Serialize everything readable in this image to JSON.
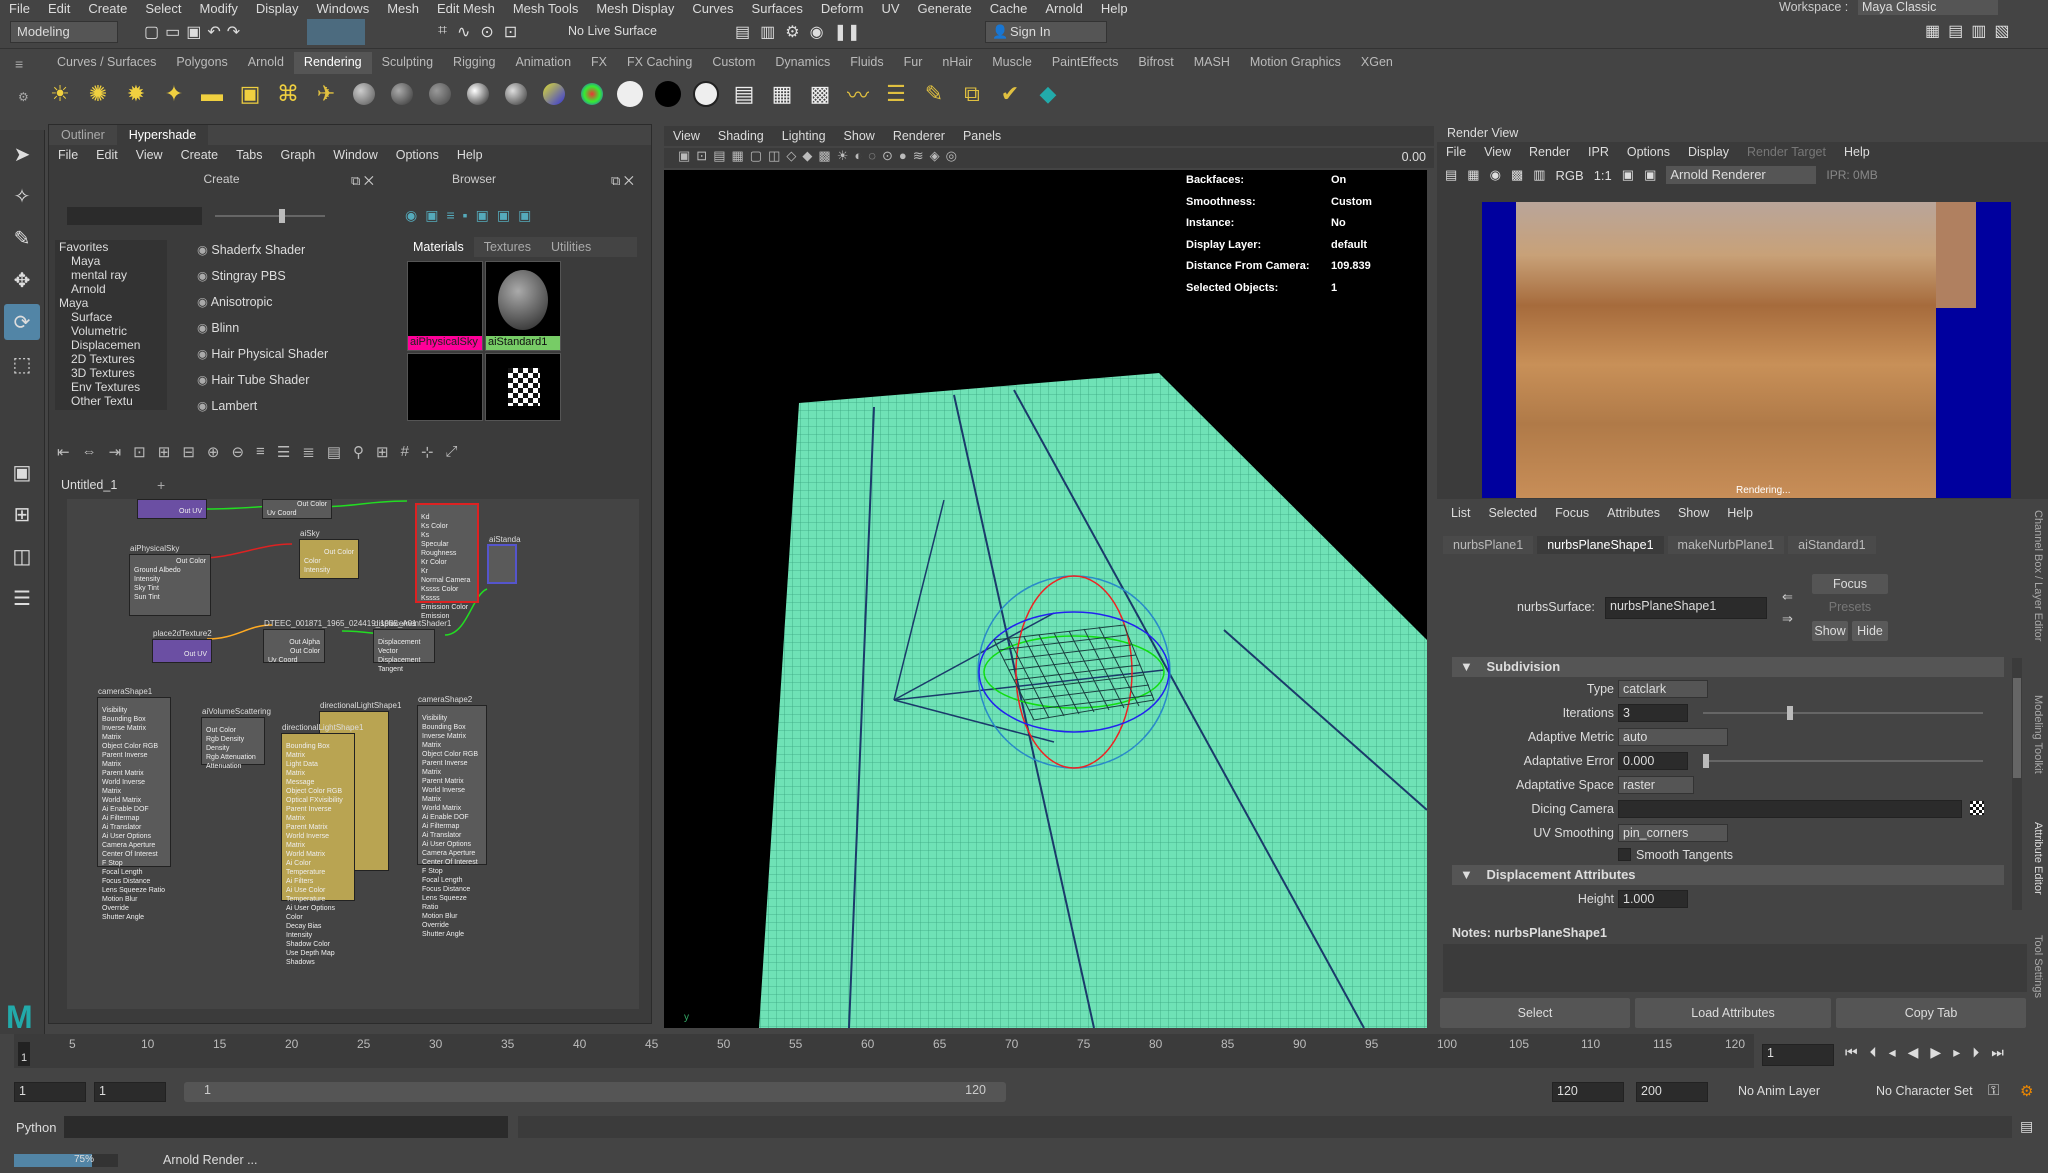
{
  "menubar": {
    "items": [
      "File",
      "Edit",
      "Create",
      "Select",
      "Modify",
      "Display",
      "Windows",
      "Mesh",
      "Edit Mesh",
      "Mesh Tools",
      "Mesh Display",
      "Curves",
      "Surfaces",
      "Deform",
      "UV",
      "Generate",
      "Cache",
      "Arnold",
      "Help"
    ],
    "workspace_label": "Workspace :",
    "workspace_value": "Maya Classic"
  },
  "statusline": {
    "mode": "Modeling",
    "live_surface": "No Live Surface",
    "sign_in": "Sign In"
  },
  "shelf": {
    "tabs": [
      "Curves / Surfaces",
      "Polygons",
      "Arnold",
      "Rendering",
      "Sculpting",
      "Rigging",
      "Animation",
      "FX",
      "FX Caching",
      "Custom",
      "Dynamics",
      "Fluids",
      "Fur",
      "nHair",
      "Muscle",
      "PaintEffects",
      "Bifrost",
      "MASH",
      "Motion Graphics",
      "XGen"
    ],
    "active_tab": "Rendering"
  },
  "hypershade": {
    "tabs": [
      "Outliner",
      "Hypershade"
    ],
    "menu": [
      "File",
      "Edit",
      "View",
      "Create",
      "Tabs",
      "Graph",
      "Window",
      "Options",
      "Help"
    ],
    "create_title": "Create",
    "browser_title": "Browser",
    "tree": [
      "Favorites",
      "Maya",
      "mental ray",
      "Arnold",
      "Maya",
      "Surface",
      "Volumetric",
      "Displacemen",
      "2D Textures",
      "3D Textures",
      "Env Textures",
      "Other Textu"
    ],
    "shader_list": [
      "Shaderfx Shader",
      "Stingray PBS",
      "Anisotropic",
      "Blinn",
      "Hair Physical Shader",
      "Hair Tube Shader",
      "Lambert"
    ],
    "browser_tabs": [
      "Materials",
      "Textures",
      "Utilities"
    ],
    "swatches": [
      "aiPhysicalSky",
      "aiStandard1"
    ],
    "graph_tab": "Untitled_1",
    "nodes": {
      "aiPhysicalSky": "aiPhysicalSky",
      "aiSky": "aiSky",
      "place2dTexture2": "place2dTexture2",
      "texture": "DTEEC_001871_1965_024419_1965_A01",
      "displacement": "displacementShader1",
      "aiStandard": "aiStanda",
      "cameraShape1": "cameraShape1",
      "aiVolumeScattering": "aiVolumeScattering",
      "dirLight1": "directionalLightShape1",
      "dirLight2": "directionalLightShape1",
      "cameraShape2": "cameraShape2"
    },
    "port_lines": {
      "sky": [
        "Out Color",
        "Ground Albedo",
        "Intensity",
        "Sky Tint",
        "Sun Tint"
      ],
      "aisky": [
        "Color",
        "Intensity",
        "Out Color"
      ],
      "place2d": [
        "Out UV"
      ],
      "tex": [
        "Out Alpha",
        "Out Color",
        "Uv Coord"
      ],
      "disp": [
        "Displacement",
        "Vector Displacement",
        "Tangent"
      ],
      "std": [
        "Kd",
        "Ks Color",
        "Ks",
        "Specular Roughness",
        "Kr Color",
        "Kr",
        "Normal Camera",
        "Kssss Color",
        "Kssss",
        "Emission Color",
        "Emission"
      ],
      "cam": [
        "Visibility",
        "Bounding Box",
        "Inverse Matrix",
        "Matrix",
        "Object Color RGB",
        "Parent Inverse Matrix",
        "Parent Matrix",
        "World Inverse Matrix",
        "World Matrix",
        "Ai Enable DOF",
        "Ai Filtermap",
        "Ai Translator",
        "Ai User Options",
        "Camera Aperture",
        "Center Of Interest",
        "F Stop",
        "Focal Length",
        "Focus Distance",
        "Lens Squeeze Ratio",
        "Motion Blur Override",
        "Shutter Angle"
      ],
      "vol": [
        "Out Color",
        "Rgb Density",
        "Density",
        "Rgb Attenuation",
        "Attenuation"
      ],
      "light": [
        "Bounding Box",
        "Matrix",
        "Light Data",
        "Matrix",
        "Message",
        "Object Color RGB",
        "Optical FXvisibility",
        "Parent Inverse Matrix",
        "Parent Matrix",
        "World Inverse Matrix",
        "World Matrix",
        "Ai Color Temperature",
        "Ai Filters",
        "Ai Use Color Temperature",
        "Ai User Options",
        "Color",
        "Decay Bias",
        "Intensity",
        "Shadow Color",
        "Use Depth Map Shadows"
      ]
    }
  },
  "viewport": {
    "menu": [
      "View",
      "Shading",
      "Lighting",
      "Show",
      "Renderer",
      "Panels"
    ],
    "value": "0.00",
    "hud": [
      {
        "k": "Backfaces:",
        "v": "On"
      },
      {
        "k": "Smoothness:",
        "v": "Custom"
      },
      {
        "k": "Instance:",
        "v": "No"
      },
      {
        "k": "Display Layer:",
        "v": "default"
      },
      {
        "k": "Distance From Camera:",
        "v": "109.839"
      },
      {
        "k": "Selected Objects:",
        "v": "1"
      }
    ]
  },
  "render_view": {
    "title": "Render View",
    "menu": [
      "File",
      "View",
      "Render",
      "IPR",
      "Options",
      "Display",
      "Render Target",
      "Help"
    ],
    "ratio": "1:1",
    "renderer": "Arnold Renderer",
    "ipr": "IPR: 0MB",
    "status": "Rendering..."
  },
  "attribute_editor": {
    "menu": [
      "List",
      "Selected",
      "Focus",
      "Attributes",
      "Show",
      "Help"
    ],
    "tabs": [
      "nurbsPlane1",
      "nurbsPlaneShape1",
      "makeNurbPlane1",
      "aiStandard1"
    ],
    "surface_label": "nurbsSurface:",
    "surface_value": "nurbsPlaneShape1",
    "focus_btn": "Focus",
    "presets_btn": "Presets",
    "show_btn": "Show",
    "hide_btn": "Hide",
    "subdivision_title": "Subdivision",
    "fields": [
      {
        "label": "Type",
        "value": "catclark"
      },
      {
        "label": "Iterations",
        "value": "3"
      },
      {
        "label": "Adaptive Metric",
        "value": "auto"
      },
      {
        "label": "Adaptative Error",
        "value": "0.000"
      },
      {
        "label": "Adaptative Space",
        "value": "raster"
      },
      {
        "label": "Dicing Camera",
        "value": ""
      },
      {
        "label": "UV Smoothing",
        "value": "pin_corners"
      }
    ],
    "smooth_tangents": "Smooth Tangents",
    "displacement_title": "Displacement Attributes",
    "height_label": "Height",
    "height_value": "1.000",
    "notes_label": "Notes:",
    "notes_value": "nurbsPlaneShape1",
    "bottom_buttons": [
      "Select",
      "Load Attributes",
      "Copy Tab"
    ],
    "side_tabs": [
      "Channel Box / Layer Editor",
      "Modeling Toolkit",
      "Attribute Editor",
      "Tool Settings"
    ]
  },
  "timeline": {
    "ticks": [
      "5",
      "10",
      "15",
      "20",
      "25",
      "30",
      "35",
      "40",
      "45",
      "50",
      "55",
      "60",
      "65",
      "70",
      "75",
      "80",
      "85",
      "90",
      "95",
      "100",
      "105",
      "110",
      "115",
      "120"
    ],
    "current": "1",
    "frame_field": "1"
  },
  "range": {
    "start": "1",
    "start2": "1",
    "slider_start": "1",
    "slider_end": "120",
    "end1": "120",
    "end2": "200",
    "anim_layer": "No Anim Layer",
    "char_set": "No Character Set"
  },
  "cmdline": {
    "label": "Python"
  },
  "helpline": {
    "progress_text": "75%",
    "progress": 0.75,
    "message": "Arnold Render ..."
  }
}
